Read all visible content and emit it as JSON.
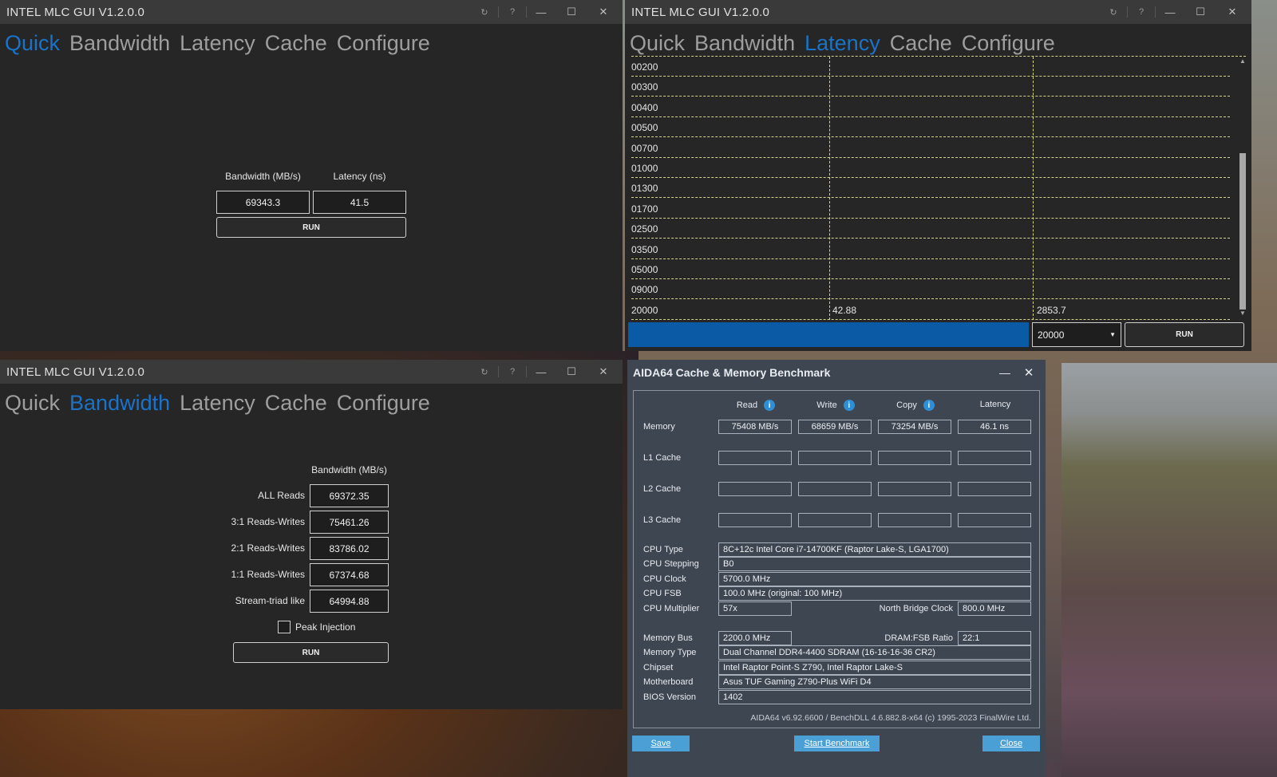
{
  "mlc_title": "INTEL MLC GUI V1.2.0.0",
  "tabs": [
    "Quick",
    "Bandwidth",
    "Latency",
    "Cache",
    "Configure"
  ],
  "titlebar_icons": [
    "refresh-icon",
    "help-icon",
    "minimize-icon",
    "maximize-icon",
    "close-icon"
  ],
  "titlebar_glyphs": {
    "refresh": "↻",
    "help": "?",
    "minimize": "—",
    "maximize": "☐",
    "close": "✕"
  },
  "quick": {
    "active_tab": "Quick",
    "bandwidth_label": "Bandwidth (MB/s)",
    "latency_label": "Latency (ns)",
    "bandwidth_value": "69343.3",
    "latency_value": "41.5",
    "run_label": "RUN"
  },
  "latency": {
    "active_tab": "Latency",
    "rows": [
      {
        "size": "00200",
        "c1": "",
        "c2": ""
      },
      {
        "size": "00300",
        "c1": "",
        "c2": ""
      },
      {
        "size": "00400",
        "c1": "",
        "c2": ""
      },
      {
        "size": "00500",
        "c1": "",
        "c2": ""
      },
      {
        "size": "00700",
        "c1": "",
        "c2": ""
      },
      {
        "size": "01000",
        "c1": "",
        "c2": ""
      },
      {
        "size": "01300",
        "c1": "",
        "c2": ""
      },
      {
        "size": "01700",
        "c1": "",
        "c2": ""
      },
      {
        "size": "02500",
        "c1": "",
        "c2": ""
      },
      {
        "size": "03500",
        "c1": "",
        "c2": ""
      },
      {
        "size": "05000",
        "c1": "",
        "c2": ""
      },
      {
        "size": "09000",
        "c1": "",
        "c2": ""
      },
      {
        "size": "20000",
        "c1": "42.88",
        "c2": "2853.7"
      }
    ],
    "progress": 1.0,
    "select_value": "20000",
    "run_label": "RUN",
    "accent": "#0b5aa6"
  },
  "bandwidth": {
    "active_tab": "Bandwidth",
    "header": "Bandwidth (MB/s)",
    "rows": [
      {
        "label": "ALL Reads",
        "value": "69372.35"
      },
      {
        "label": "3:1 Reads-Writes",
        "value": "75461.26"
      },
      {
        "label": "2:1 Reads-Writes",
        "value": "83786.02"
      },
      {
        "label": "1:1 Reads-Writes",
        "value": "67374.68"
      },
      {
        "label": "Stream-triad like",
        "value": "64994.88"
      }
    ],
    "peak_label": "Peak Injection",
    "run_label": "RUN"
  },
  "aida": {
    "title": "AIDA64 Cache & Memory Benchmark",
    "columns": [
      "Read",
      "Write",
      "Copy",
      "Latency"
    ],
    "rows": [
      {
        "label": "Memory",
        "values": [
          "75408 MB/s",
          "68659 MB/s",
          "73254 MB/s",
          "46.1 ns"
        ]
      },
      {
        "label": "L1 Cache",
        "values": [
          "",
          "",
          "",
          ""
        ]
      },
      {
        "label": "L2 Cache",
        "values": [
          "",
          "",
          "",
          ""
        ]
      },
      {
        "label": "L3 Cache",
        "values": [
          "",
          "",
          "",
          ""
        ]
      }
    ],
    "info": {
      "cpu_type_label": "CPU Type",
      "cpu_type": "8C+12c Intel Core i7-14700KF  (Raptor Lake-S, LGA1700)",
      "cpu_stepping_label": "CPU Stepping",
      "cpu_stepping": "B0",
      "cpu_clock_label": "CPU Clock",
      "cpu_clock": "5700.0 MHz",
      "cpu_fsb_label": "CPU FSB",
      "cpu_fsb": "100.0 MHz  (original: 100 MHz)",
      "cpu_mult_label": "CPU Multiplier",
      "cpu_mult": "57x",
      "nb_clock_label": "North Bridge Clock",
      "nb_clock": "800.0 MHz",
      "mem_bus_label": "Memory Bus",
      "mem_bus": "2200.0 MHz",
      "dram_ratio_label": "DRAM:FSB Ratio",
      "dram_ratio": "22:1",
      "mem_type_label": "Memory Type",
      "mem_type": "Dual Channel DDR4-4400 SDRAM  (16-16-16-36 CR2)",
      "chipset_label": "Chipset",
      "chipset": "Intel Raptor Point-S Z790, Intel Raptor Lake-S",
      "mobo_label": "Motherboard",
      "mobo": "Asus TUF Gaming Z790-Plus WiFi D4",
      "bios_label": "BIOS Version",
      "bios": "1402"
    },
    "footer": "AIDA64 v6.92.6600 / BenchDLL 4.6.882.8-x64  (c) 1995-2023 FinalWire Ltd.",
    "save_label": "Save",
    "start_label": "Start Benchmark",
    "close_label": "Close",
    "min_glyph": "—",
    "close_glyph": "✕",
    "info_glyph": "i"
  }
}
